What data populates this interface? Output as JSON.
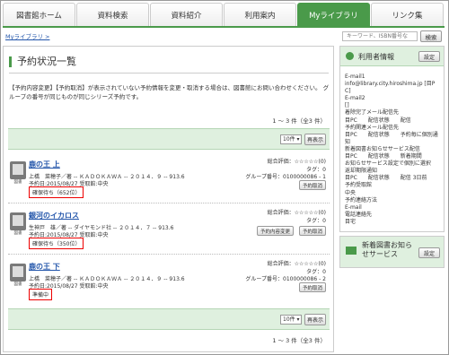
{
  "tabs": [
    "図書館ホーム",
    "資料検索",
    "資料紹介",
    "利用案内",
    "Myライブラリ",
    "リンク集"
  ],
  "breadcrumb": "Myライブラリ >",
  "search": {
    "placeholder": "キーワード、ISBN番号な",
    "button": "検索"
  },
  "page_title": "予約状況一覧",
  "intro": "【予約内容変更】【予約取消】が表示されていない予約情報を変更・取消する場合は、図書館にお問い合わせください。 グループの番号が同じものが同じシリーズ予約です。",
  "result_count": "1 ～ 3 件（全3 件）",
  "pager": {
    "per_page": "10件 ▾",
    "redisplay": "再表示"
  },
  "items": [
    {
      "title": "鹿の王 上",
      "meta": "上橋　菜穂子／著 -- ＫＡＤＯＫＡＷＡ -- ２０１４．９ -- 913.6",
      "meta2": "予約日:2015/08/27 受取館:中央",
      "status": "確保待ち（652位）",
      "rating": "総合評価：☆☆☆☆☆(0)",
      "tags": "タグ：0",
      "group": "グループ番号：0100000086 - 1",
      "buttons": [
        "予約取消"
      ],
      "icon_label": "図書"
    },
    {
      "title": "銀河のイカロス",
      "meta": "生神戸　雄／著 -- ダイヤモンド社 -- ２０１４．７ -- 913.6",
      "meta2": "予約日:2015/08/27 受取館:中央",
      "status": "確保待ち（350位）",
      "rating": "総合評価：☆☆☆☆☆(0)",
      "tags": "タグ：0",
      "group": "",
      "buttons": [
        "予約内容変更",
        "予約取消"
      ],
      "icon_label": "図書"
    },
    {
      "title": "鹿の王 下",
      "meta": "上橋　菜穂子／著 -- ＫＡＤＯＫＡＷＡ -- ２０１４．９ -- 913.6",
      "meta2": "予約日:2015/08/27 受取館:中央",
      "status": "準備中",
      "rating": "総合評価：☆☆☆☆☆(0)",
      "tags": "タグ：0",
      "group": "グループ番号：0100000086 - 2",
      "buttons": [
        "予約取消"
      ],
      "icon_label": "図書"
    }
  ],
  "sidebar": {
    "user_info_title": "利用者情報",
    "settings": "設定",
    "user_info_lines": [
      "E-mail1",
      "info@library.city.hiroshima.jp [目PC]",
      "E-mail2",
      "[]",
      "着除完了メール配信先",
      "目PC　　配信状態　　配信",
      "予約関連メール配信先",
      "目PC　　配信状態　　予約毎に個別通知",
      "新着図書お知らせサービス配信",
      "目PC　　配信状態　　新着期間",
      "お知らせサービス設定で個別に選択",
      "返却期限通知",
      "目PC　　配信状態　　配信 3日前",
      "予約受取館",
      "中央",
      "予約連絡方法",
      "E-mail",
      "電話連絡先",
      "目宅"
    ],
    "new_books_title": "新着図書お知らせサービス",
    "new_books_settings": "設定"
  },
  "colors": {
    "accent": "#4a9a4a",
    "panel": "#dff0df",
    "link": "#2255aa",
    "highlight": "#ee0000"
  }
}
